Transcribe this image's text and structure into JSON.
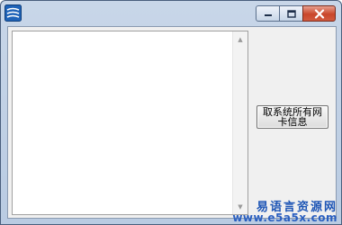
{
  "window": {
    "title": "",
    "icon": "app-icon",
    "title_buttons": {
      "minimize_icon": "minimize-icon",
      "maximize_icon": "maximize-icon",
      "close_icon": "close-icon"
    },
    "colors": {
      "close_button": "#c9462a",
      "titlebar": "#c8d6e8"
    }
  },
  "main": {
    "list_items": [],
    "action_button_label": "取系统所有网卡信息"
  },
  "watermark": {
    "line1": "易语言资源网",
    "line2": "www.e5a5x.com",
    "color": "#1d55b5"
  }
}
